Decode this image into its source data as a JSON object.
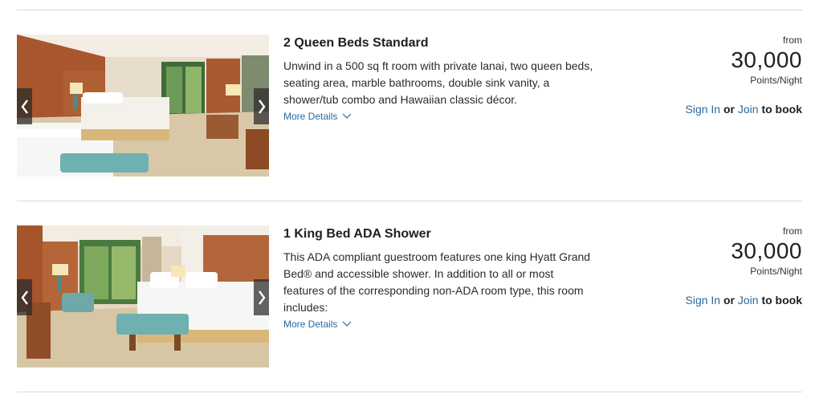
{
  "rooms": [
    {
      "title": "2 Queen Beds Standard",
      "description": "Unwind in a 500 sq ft room with private lanai, two queen beds, seating area, marble bathrooms, double sink vanity, a shower/tub combo and Hawaiian classic décor.",
      "more_details": "More Details",
      "from_label": "from",
      "points": "30,000",
      "unit": "Points/Night",
      "sign_in": "Sign In",
      "or": "or",
      "join": "Join",
      "to_book": "to book"
    },
    {
      "title": "1 King Bed ADA Shower",
      "description": "This ADA compliant guestroom features one king Hyatt Grand Bed® and accessible shower. In addition to all or most features of the corresponding non-ADA room type, this room includes:",
      "more_details": "More Details",
      "from_label": "from",
      "points": "30,000",
      "unit": "Points/Night",
      "sign_in": "Sign In",
      "or": "or",
      "join": "Join",
      "to_book": "to book"
    }
  ],
  "colors": {
    "link": "#2a6a9e",
    "divider": "#d9d9d9",
    "arrow_bg": "#282828"
  },
  "icons": {
    "prev": "chevron-left-icon",
    "next": "chevron-right-icon",
    "expand": "chevron-down-icon"
  }
}
